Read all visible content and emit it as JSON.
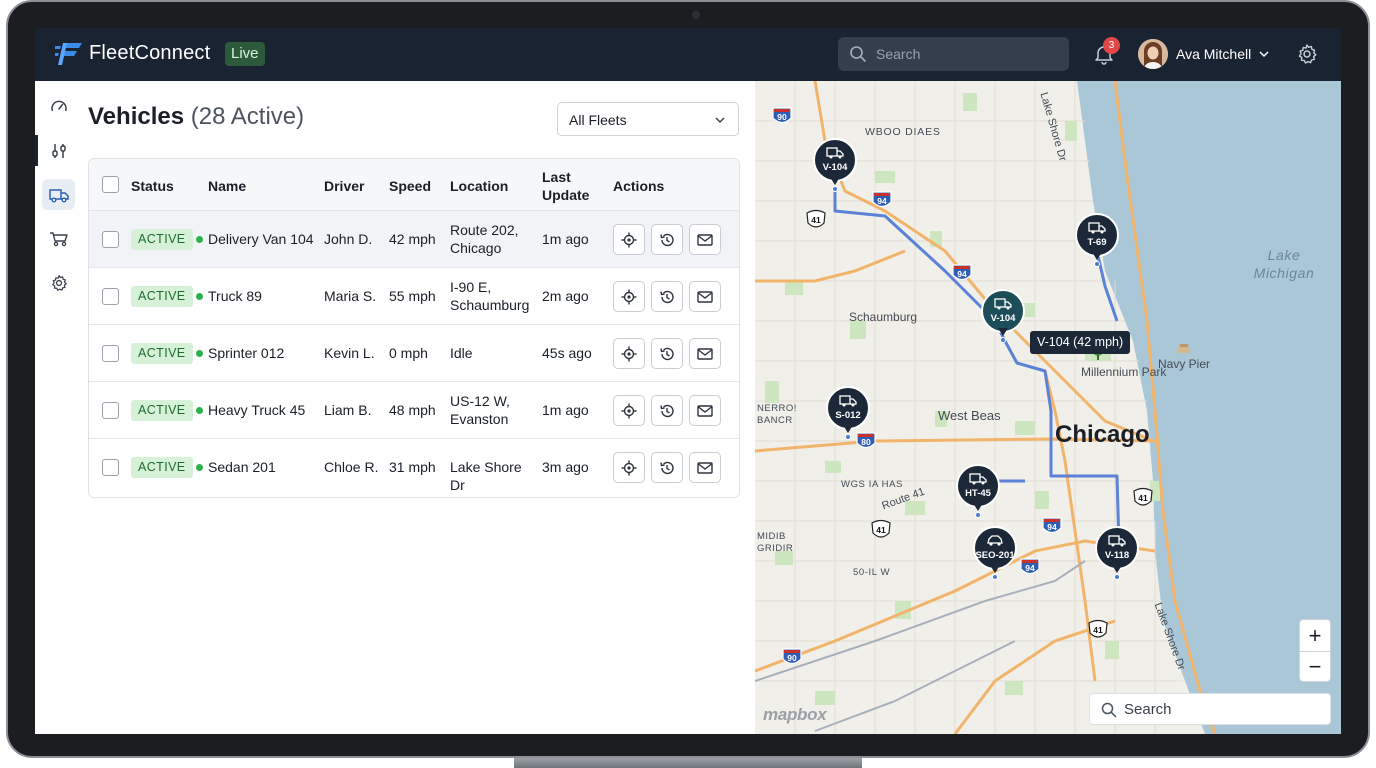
{
  "app": {
    "title": "FleetConnect",
    "badge": "Live"
  },
  "topbar": {
    "search_placeholder": "Search",
    "notifications_count": "3",
    "user_name": "Ava Mitchell"
  },
  "sidebar": {
    "items": [
      {
        "name": "dashboard",
        "icon": "speedometer-icon"
      },
      {
        "name": "sensors",
        "icon": "sliders-icon"
      },
      {
        "name": "vehicles",
        "icon": "truck-icon",
        "active": true
      },
      {
        "name": "routes",
        "icon": "cart-icon"
      },
      {
        "name": "settings",
        "icon": "gear-icon"
      }
    ]
  },
  "main": {
    "title": "Vehicles",
    "count_label": "(28 Active)",
    "fleet_filter": "All Fleets",
    "columns": [
      "Status",
      "Name",
      "Driver",
      "Speed",
      "Location",
      "Last Update",
      "Actions"
    ],
    "rows": [
      {
        "status": "ACTIVE",
        "name": "Delivery Van 104",
        "driver": "John D.",
        "speed": "42 mph",
        "location": "Route 202, Chicago",
        "updated": "1m ago"
      },
      {
        "status": "ACTIVE",
        "name": "Truck 89",
        "driver": "Maria S.",
        "speed": "55 mph",
        "location": "I-90 E, Schaumburg",
        "updated": "2m ago"
      },
      {
        "status": "ACTIVE",
        "name": "Sprinter 012",
        "driver": "Kevin L.",
        "speed": "0 mph",
        "location": "Idle",
        "updated": "45s ago"
      },
      {
        "status": "ACTIVE",
        "name": "Heavy Truck 45",
        "driver": "Liam B.",
        "speed": "48 mph",
        "location": "US-12 W, Evanston",
        "updated": "1m ago"
      },
      {
        "status": "ACTIVE",
        "name": "Sedan 201",
        "driver": "Chloe R.",
        "speed": "31 mph",
        "location": "Lake Shore Dr",
        "updated": "3m ago"
      }
    ]
  },
  "map": {
    "labels": {
      "chicago": "Chicago",
      "lake": "Lake Michigan",
      "schaumburg": "Schaumburg",
      "west_beas": "West Beas",
      "millennium_park": "Millennium Park",
      "navy_pier": "Navy Pier",
      "lake_shore_top": "Lake Shore Dr",
      "lake_shore_bottom": "Lake Shore Dr",
      "route41": "Route 41",
      "wboo": "WBOO DIAES",
      "nerro": "NERRO! BANCR",
      "wgs": "WGS IA HAS",
      "midib": "MIDIB GRIDIR",
      "so": "50-IL W"
    },
    "pins": [
      {
        "label": "V-104"
      },
      {
        "label": "T-69"
      },
      {
        "label": "V-104"
      },
      {
        "label": "S-012"
      },
      {
        "label": "HT-45"
      },
      {
        "label": "SEO-201"
      },
      {
        "label": "V-118"
      }
    ],
    "tooltip": "V-104 (42 mph)",
    "highway_shields": [
      "90",
      "94",
      "41",
      "94",
      "80",
      "41",
      "94",
      "94",
      "41",
      "90",
      "41"
    ],
    "search_placeholder": "Search",
    "attribution": "mapbox",
    "zoom_in": "+",
    "zoom_out": "−"
  },
  "colors": {
    "topbar": "#1a2332",
    "accent": "#2bb24c",
    "route": "#5b82d6",
    "pin": "#1c2838"
  }
}
